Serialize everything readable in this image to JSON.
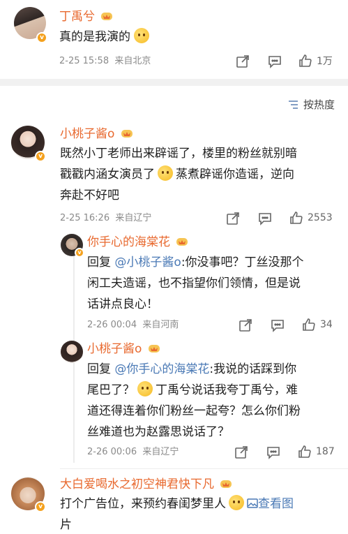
{
  "top_post": {
    "author": "丁禹兮",
    "text": "真的是我演的",
    "time": "2-25 15:58",
    "source": "来自北京",
    "like_count": "1万"
  },
  "sort": {
    "label": "按热度"
  },
  "comments": [
    {
      "author": "小桃子酱o",
      "text_a": "既然小丁老师出来辟谣了，楼里的粉丝就别暗",
      "text_b": "戳戳内涵女演员了",
      "text_c": "蒸煮辟谣你造谣，逆向",
      "text_d": "奔赴不好吧",
      "time": "2-25 16:26",
      "source": "来自辽宁",
      "like_count": "2553"
    },
    {
      "author": "你手心的海棠花",
      "reply_prefix": "回复",
      "reply_target": "@小桃子酱o",
      "line1": ":你没事吧？丁丝没那个",
      "line2": "闲工夫造谣，也不指望你们领情，但是说",
      "line3": "话讲点良心！",
      "time": "2-26 00:04",
      "source": "来自河南",
      "like_count": "34"
    },
    {
      "author": "小桃子酱o",
      "reply_prefix": "回复",
      "reply_target": "@你手心的海棠花",
      "line1": ":我说的话踩到你",
      "line2a": "尾巴了？",
      "line2b": "丁禹兮说话我夸丁禹兮，难",
      "line3": "道还得连着你们粉丝一起夸？怎么你们粉",
      "line4": "丝难道也为赵露思说话了？",
      "time": "2-26 00:06",
      "source": "来自辽宁",
      "like_count": "187"
    },
    {
      "author": "大白爱喝水之初空神君快下凡",
      "line1": "打个广告位，来预约春闺梦里人",
      "view_image": "查看图",
      "line2": "片"
    }
  ],
  "icons": {
    "share": "share-icon",
    "comment": "comment-icon",
    "like": "thumbs-up-icon",
    "sort": "sort-icon",
    "verified": "verified-badge-icon",
    "crown": "fan-crown-icon"
  },
  "colors": {
    "name": "#e8692f",
    "link": "#4a79b5",
    "meta": "#8a8a8a",
    "badge": "#f4a11e"
  }
}
